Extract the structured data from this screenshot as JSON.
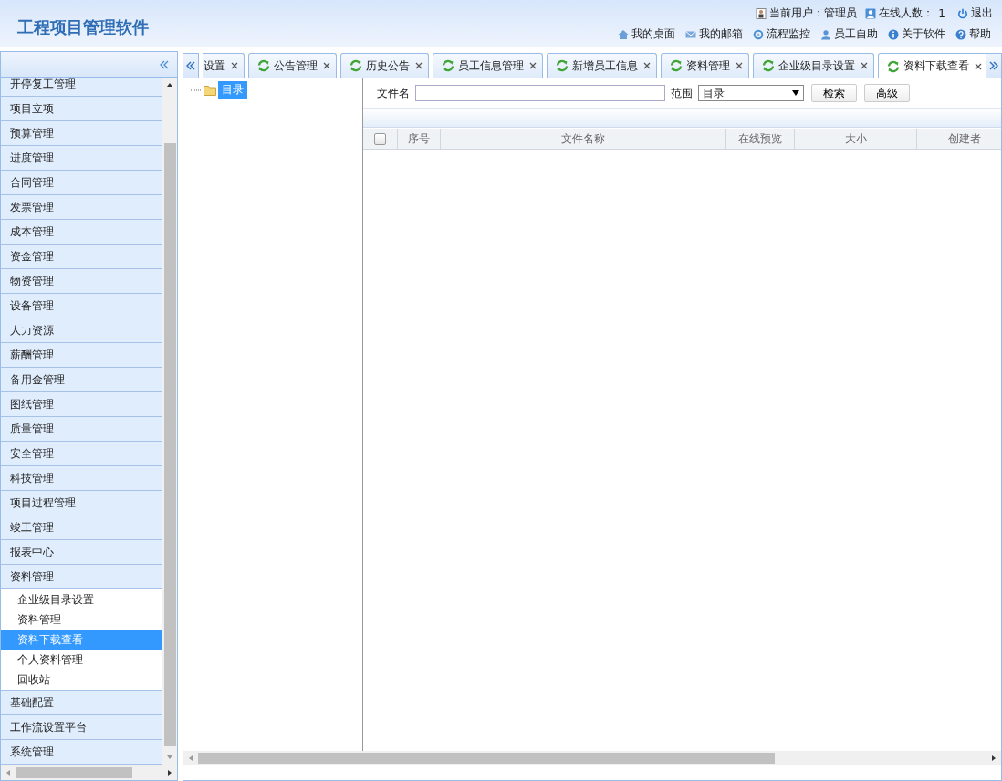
{
  "header": {
    "title": "工程项目管理软件",
    "user_label": "当前用户：管理员",
    "online_label": "在线人数：",
    "online_count": "1",
    "logout": "退出",
    "links": [
      {
        "label": "我的桌面"
      },
      {
        "label": "我的邮箱"
      },
      {
        "label": "流程监控"
      },
      {
        "label": "员工自助"
      },
      {
        "label": "关于软件"
      },
      {
        "label": "帮助"
      }
    ]
  },
  "sidebar": {
    "items": [
      {
        "label": "开停复工管理"
      },
      {
        "label": "项目立项"
      },
      {
        "label": "预算管理"
      },
      {
        "label": "进度管理"
      },
      {
        "label": "合同管理"
      },
      {
        "label": "发票管理"
      },
      {
        "label": "成本管理"
      },
      {
        "label": "资金管理"
      },
      {
        "label": "物资管理"
      },
      {
        "label": "设备管理"
      },
      {
        "label": "人力资源"
      },
      {
        "label": "薪酬管理"
      },
      {
        "label": "备用金管理"
      },
      {
        "label": "图纸管理"
      },
      {
        "label": "质量管理"
      },
      {
        "label": "安全管理"
      },
      {
        "label": "科技管理"
      },
      {
        "label": "项目过程管理"
      },
      {
        "label": "竣工管理"
      },
      {
        "label": "报表中心"
      },
      {
        "label": "资料管理",
        "children": [
          {
            "label": "企业级目录设置",
            "selected": false
          },
          {
            "label": "资料管理",
            "selected": false
          },
          {
            "label": "资料下载查看",
            "selected": true
          },
          {
            "label": "个人资料管理",
            "selected": false
          },
          {
            "label": "回收站",
            "selected": false
          }
        ]
      },
      {
        "label": "基础配置"
      },
      {
        "label": "工作流设置平台"
      },
      {
        "label": "系统管理"
      }
    ]
  },
  "tabs": [
    {
      "label": "设置",
      "cut": true,
      "selected": false
    },
    {
      "label": "公告管理",
      "cut": false,
      "selected": false
    },
    {
      "label": "历史公告",
      "cut": false,
      "selected": false
    },
    {
      "label": "员工信息管理",
      "cut": false,
      "selected": false
    },
    {
      "label": "新增员工信息",
      "cut": false,
      "selected": false
    },
    {
      "label": "资料管理",
      "cut": false,
      "selected": false
    },
    {
      "label": "企业级目录设置",
      "cut": false,
      "selected": false
    },
    {
      "label": "资料下载查看",
      "cut": false,
      "selected": true
    }
  ],
  "tree": {
    "root": {
      "label": "目录",
      "selected": true
    }
  },
  "search": {
    "filename_label": "文件名",
    "scope_label": "范围",
    "scope_value": "目录",
    "search_button": "检索",
    "advanced_button": "高级"
  },
  "table": {
    "select_all_checked": false,
    "columns": [
      "序号",
      "文件名称",
      "在线预览",
      "大小",
      "创建者"
    ]
  }
}
